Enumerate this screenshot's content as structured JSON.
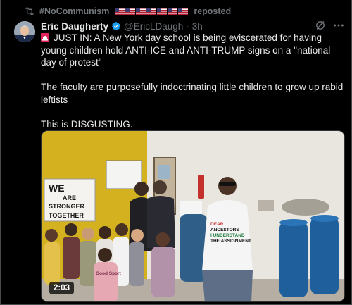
{
  "repost": {
    "hashtag": "#NoCommunism",
    "suffix": "reposted",
    "flag_count": 7,
    "icon": "repost-icon"
  },
  "post": {
    "author_name": "Eric Daugherty",
    "verified": true,
    "handle": "@EricLDaugh",
    "separator": "·",
    "time": "3h",
    "paragraphs": [
      "JUST IN: A New York day school is being eviscerated for having young children hold ANTI-ICE and ANTI-TRUMP signs on a \"national day of protest\"",
      "The faculty are purposefully indoctrinating little children to grow up rabid leftists",
      "This is DISGUSTING."
    ],
    "lead_icon": "siren-icon"
  },
  "media": {
    "duration": "2:03",
    "sign_text": [
      "WE",
      "ARE",
      "STRONGER",
      "TOGETHER"
    ],
    "shirt_text": [
      "DEAR",
      "ANCESTORS",
      "I UNDERSTAND",
      "THE ASSIGNMENT."
    ],
    "child_shirt_text": "Good Sport"
  },
  "colors": {
    "background": "#000000",
    "text": "#e7e9ea",
    "muted": "#71767b",
    "verified": "#1d9bf0",
    "wall_yellow": "#d4b21f",
    "barrel_blue": "#1f5f9c"
  }
}
